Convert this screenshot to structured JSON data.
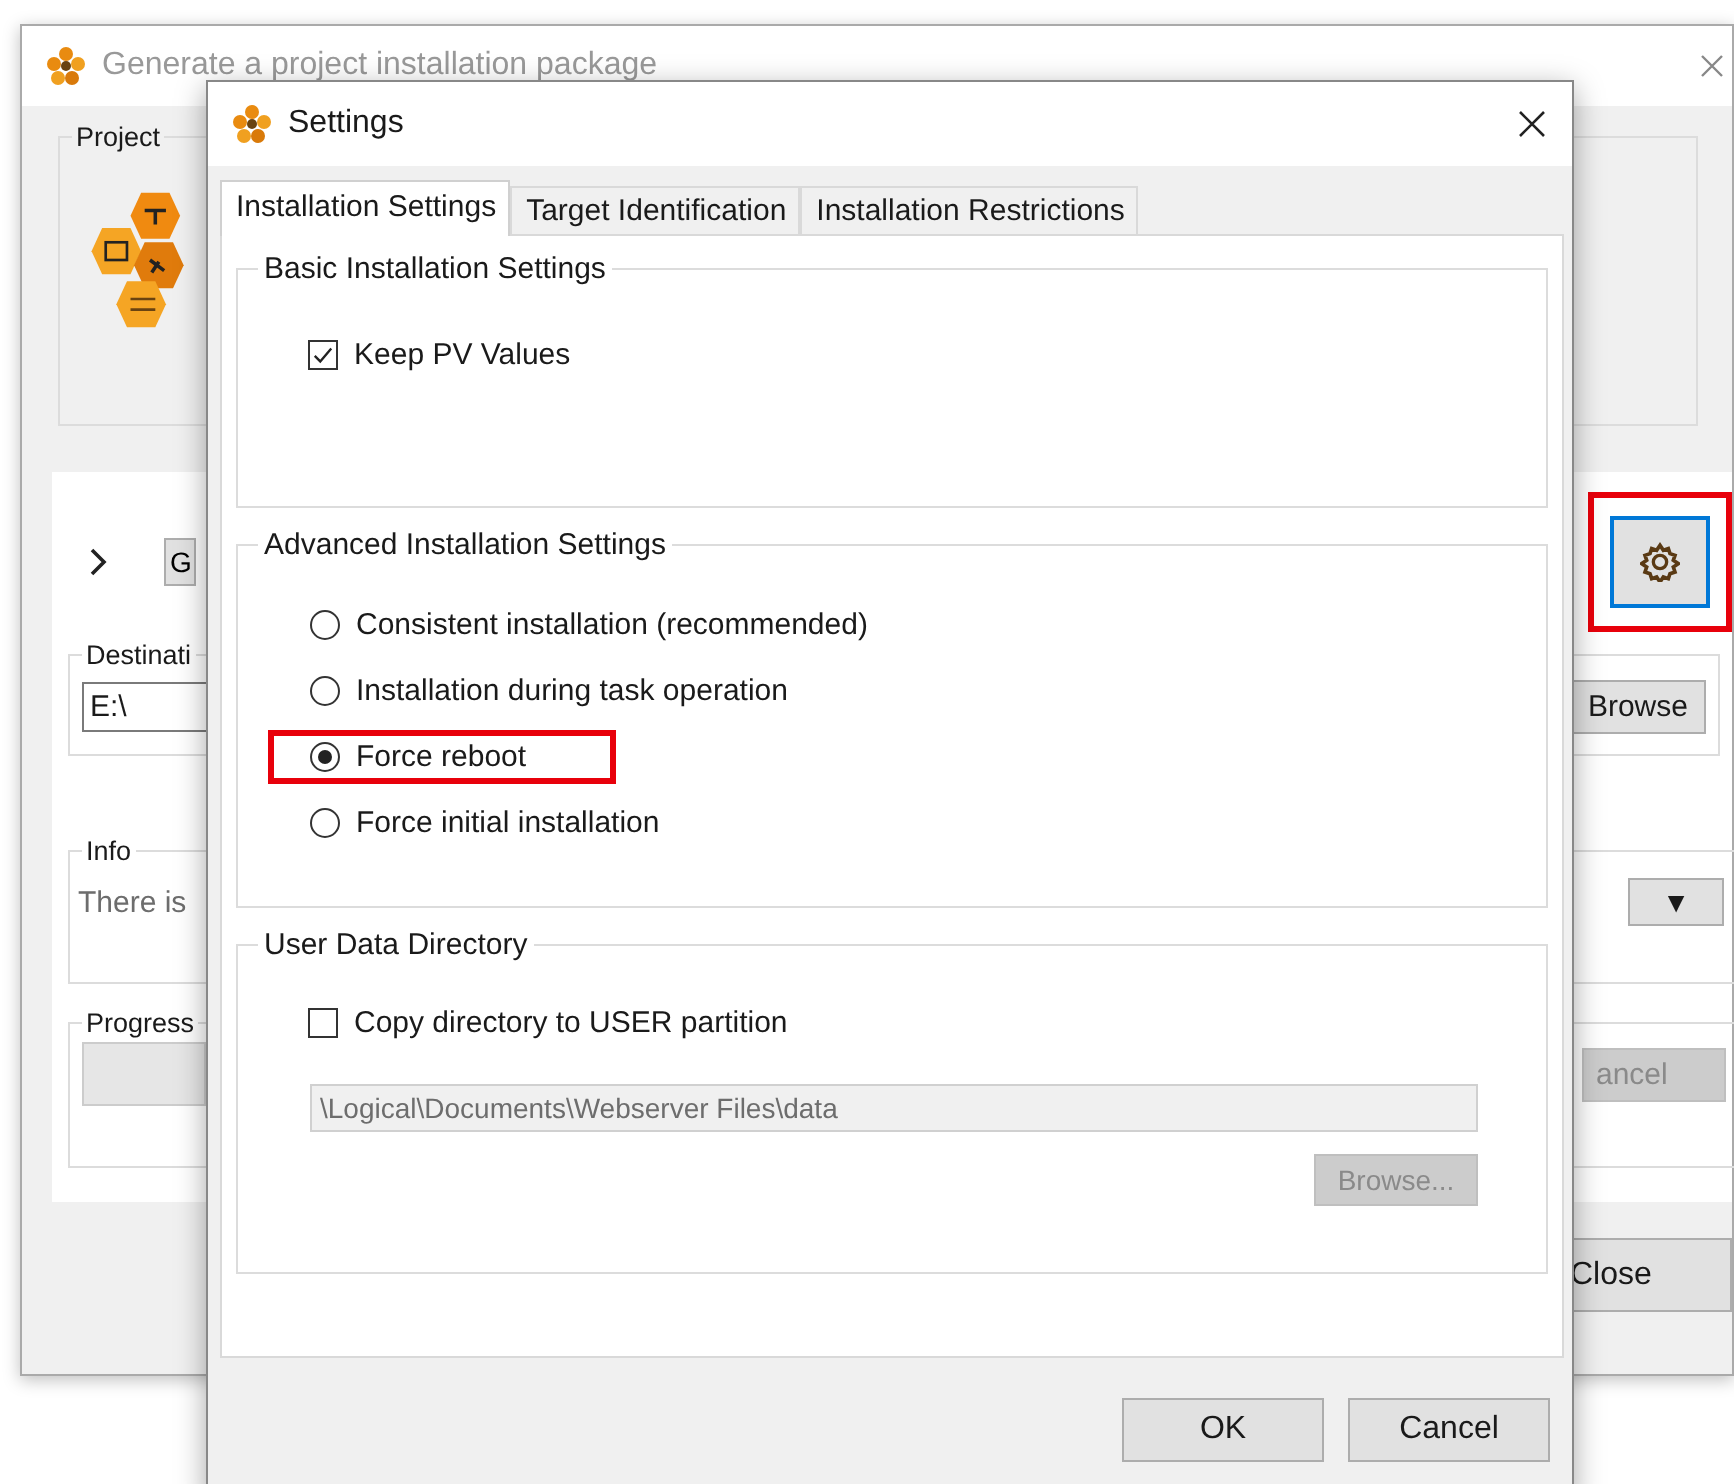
{
  "main_window": {
    "title": "Generate a project installation package",
    "project_group": {
      "label": "Project"
    },
    "g_button": {
      "label": "G"
    },
    "settings_button": {
      "highlighted": true
    },
    "destination": {
      "label": "Destinati",
      "value": "E:\\",
      "browse_button": "Browse"
    },
    "info": {
      "label": "Info",
      "text": "There is",
      "toggle_button": "▼"
    },
    "progress": {
      "label": "Progress",
      "level": 0,
      "cancel_button": {
        "label": "ancel",
        "disabled": true
      }
    },
    "close_button": "Close"
  },
  "dialog": {
    "title": "Settings",
    "tabs": [
      {
        "label": "Installation Settings",
        "selected": true
      },
      {
        "label": "Target Identification",
        "selected": false
      },
      {
        "label": "Installation Restrictions",
        "selected": false
      }
    ],
    "basic": {
      "title": "Basic Installation Settings",
      "checkboxes": [
        {
          "label": "Keep PV Values",
          "checked": true
        }
      ]
    },
    "advanced": {
      "title": "Advanced Installation Settings",
      "options": [
        {
          "label": "Consistent installation (recommended)",
          "selected": false,
          "highlighted": false
        },
        {
          "label": "Installation during task operation",
          "selected": false,
          "highlighted": false
        },
        {
          "label": "Force reboot",
          "selected": true,
          "highlighted": true
        },
        {
          "label": "Force initial installation",
          "selected": false,
          "highlighted": false
        }
      ]
    },
    "user_data": {
      "title": "User Data Directory",
      "checkbox": {
        "label": "Copy directory to USER partition",
        "checked": false
      },
      "path": {
        "value": "\\Logical\\Documents\\Webserver Files\\data",
        "disabled": true
      },
      "browse_button": {
        "label": "Browse...",
        "disabled": true
      }
    },
    "buttons": [
      "OK",
      "Cancel"
    ]
  }
}
